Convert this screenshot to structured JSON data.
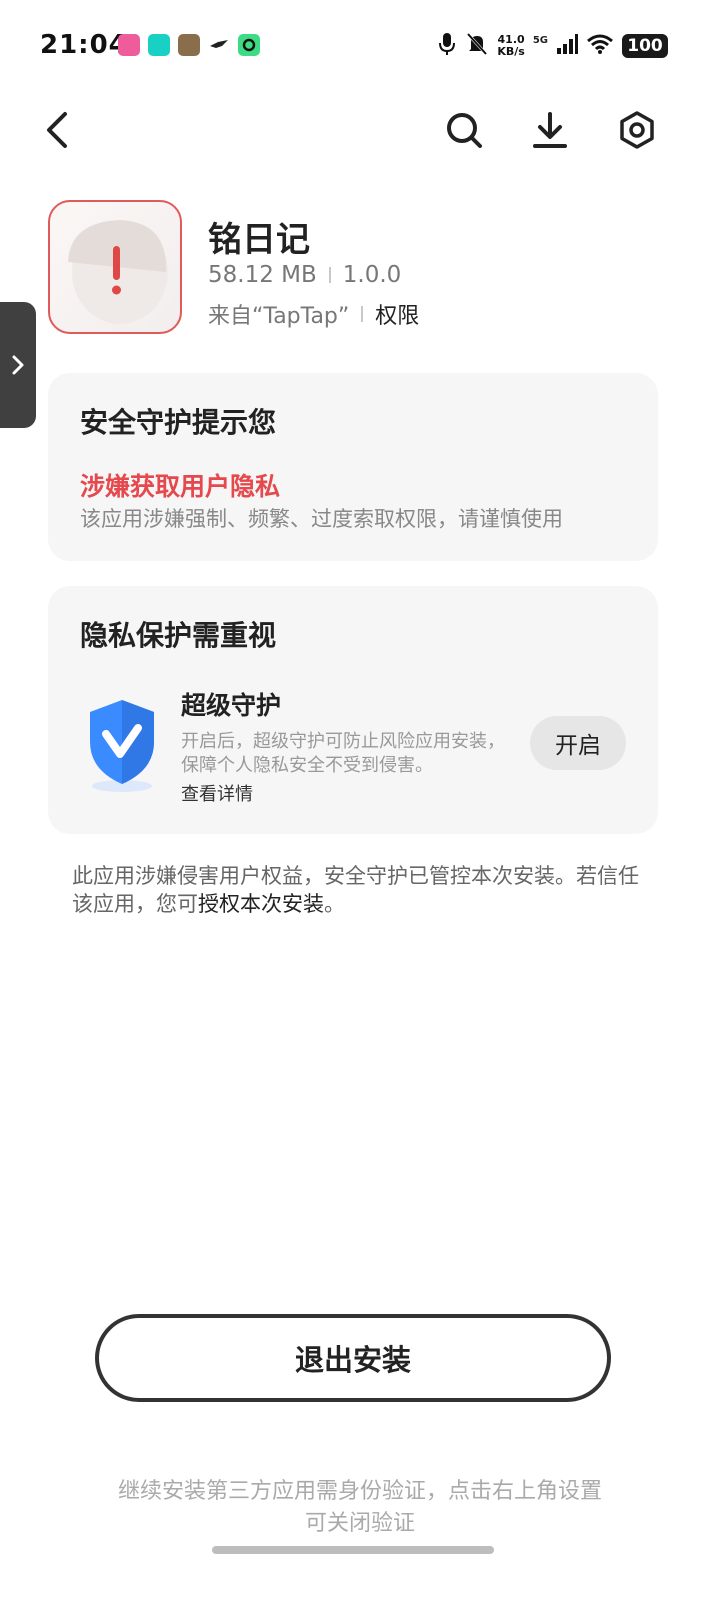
{
  "status_bar": {
    "time": "21:04",
    "net_speed_value": "41.0",
    "net_speed_unit": "KB/s",
    "network_type": "5G",
    "battery": "100",
    "notification_icons": [
      "pink-app-icon",
      "taptap-icon",
      "game-app-icon",
      "bird-app-icon",
      "green-app-icon"
    ]
  },
  "nav": {
    "back": "back-icon",
    "search": "search-icon",
    "download": "download-icon",
    "settings": "settings-icon"
  },
  "app": {
    "name": "铭日记",
    "size": "58.12 MB",
    "version": "1.0.0",
    "source": "来自“TapTap”",
    "permissions_link": "权限"
  },
  "security_card": {
    "title": "安全守护提示您",
    "risk_title": "涉嫌获取用户隐私",
    "risk_desc": "该应用涉嫌强制、频繁、过度索取权限，请谨慎使用"
  },
  "privacy_card": {
    "title": "隐私保护需重视",
    "feature_title": "超级守护",
    "feature_desc": "开启后，超级守护可防止风险应用安装，保障个人隐私安全不受到侵害。",
    "details_link": "查看详情",
    "enable_button": "开启"
  },
  "notice": {
    "text": "此应用涉嫌侵害用户权益，安全守护已管控本次安装。若信任该应用，您可",
    "authorize_link": "授权本次安装",
    "suffix": "。"
  },
  "exit_button": "退出安装",
  "footer_note": "继续安装第三方应用需身份验证，点击右上角设置可关闭验证",
  "colors": {
    "risk_red": "#e5484d",
    "card_bg": "#f6f6f6",
    "shield_blue": "#3a8bff"
  }
}
